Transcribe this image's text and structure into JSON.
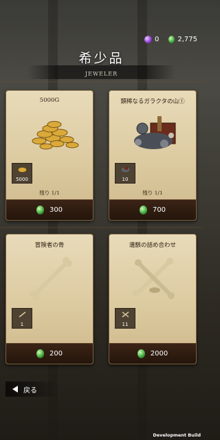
{
  "currency": {
    "premium": "0",
    "gems": "2,775"
  },
  "header": {
    "title": "希少品",
    "subtitle": "JEWELER"
  },
  "cards": [
    {
      "name": "5000G",
      "thumb_qty": "5000",
      "remaining": "残り 1/1",
      "price": "300"
    },
    {
      "name": "類稀なるガラクタの山①",
      "thumb_qty": "10",
      "remaining": "残り 1/1",
      "price": "700"
    },
    {
      "name": "冒険者の骨",
      "thumb_qty": "1",
      "price": "200"
    },
    {
      "name": "遺骸の詰め合わせ",
      "thumb_qty": "11",
      "price": "2000"
    }
  ],
  "back_label": "戻る",
  "footer": {
    "build": "Development Build"
  }
}
